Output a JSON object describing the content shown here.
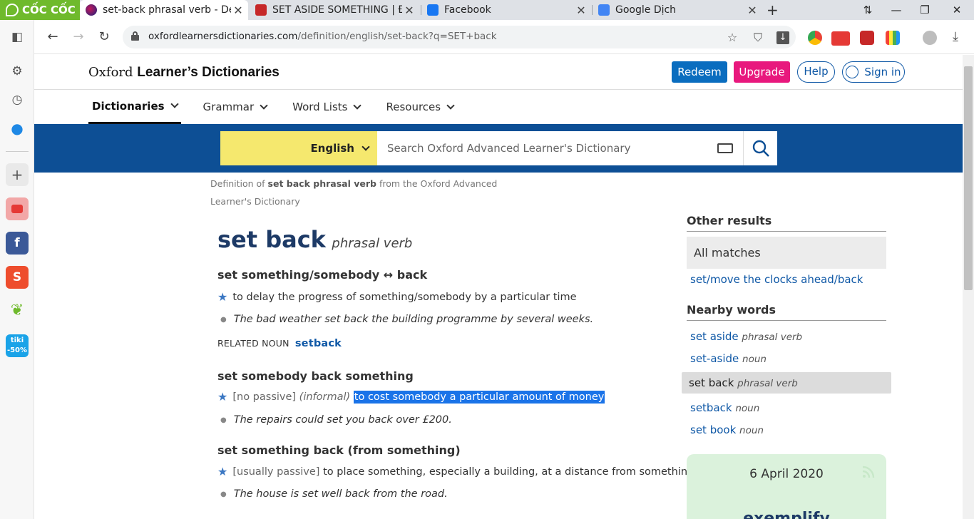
{
  "browser": {
    "brand": "CỐC CỐC",
    "tabs": [
      {
        "title": "set-back phrasal verb - Definition",
        "active": true
      },
      {
        "title": "SET ASIDE SOMETHING | Định nghĩa"
      },
      {
        "title": "Facebook"
      },
      {
        "title": "Google Dịch"
      }
    ],
    "url_domain": "oxfordlearnersdictionaries.com",
    "url_path": "/definition/english/set-back?q=SET+back"
  },
  "site": {
    "logo_regular": "Oxford",
    "logo_bold": "Learner’s Dictionaries",
    "buttons": {
      "redeem": "Redeem",
      "upgrade": "Upgrade",
      "help": "Help",
      "signin": "Sign in"
    },
    "nav": [
      "Dictionaries",
      "Grammar",
      "Word Lists",
      "Resources"
    ],
    "search": {
      "language": "English",
      "placeholder": "Search Oxford Advanced Learner's Dictionary"
    }
  },
  "entry": {
    "crumb_pre": "Definition of",
    "crumb_bold": "set back phrasal verb",
    "crumb_post": "from the Oxford Advanced Learner's Dictionary",
    "headword": "set back",
    "pos": "phrasal verb",
    "senses": [
      {
        "heading": "set something/somebody ↔ back",
        "definition": "to delay the progress of something/somebody by a particular time",
        "example": "The bad weather set back the building programme by several weeks.",
        "related_label": "RELATED NOUN",
        "related_word": "setback"
      },
      {
        "heading": "set somebody back something",
        "grammar": "[no passive]",
        "register": "(informal)",
        "definition": "to cost somebody a particular amount of money",
        "example": "The repairs could set you back over £200."
      },
      {
        "heading": "set something back (from something)",
        "grammar": "[usually passive]",
        "definition": "to place something, especially a building, at a distance from something",
        "example": "The house is set well back from the road."
      }
    ]
  },
  "sidebar": {
    "other_results": {
      "heading": "Other results",
      "all_matches": "All matches",
      "links": [
        {
          "word": "set/move the clocks ahead/back"
        }
      ]
    },
    "nearby": {
      "heading": "Nearby words",
      "items": [
        {
          "word": "set aside",
          "pos": "phrasal verb"
        },
        {
          "word": "set-aside",
          "pos": "noun"
        },
        {
          "word": "set back",
          "pos": "phrasal verb",
          "current": true
        },
        {
          "word": "setback",
          "pos": "noun"
        },
        {
          "word": "set book",
          "pos": "noun"
        }
      ]
    },
    "word_of_the_day": {
      "date": "6 April 2020",
      "word": "exemplify"
    }
  },
  "colors": {
    "brand_blue": "#0d4f95",
    "lang_yellow": "#f5e86e",
    "upgrade": "#e8187d",
    "redeem": "#0a6dbf",
    "highlight": "#1a73e8"
  }
}
